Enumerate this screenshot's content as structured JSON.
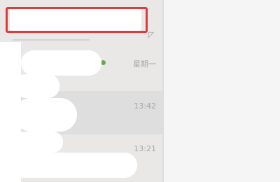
{
  "search": {
    "placeholder": ""
  },
  "chats": [
    {
      "time": "星期一"
    },
    {
      "time": "13:42"
    },
    {
      "time": "13:21"
    }
  ],
  "colors": {
    "highlight": "#e03a3a",
    "list_background": "#e9e8e7",
    "selected_row": "#dedede",
    "time_text": "#a6a6a6"
  }
}
